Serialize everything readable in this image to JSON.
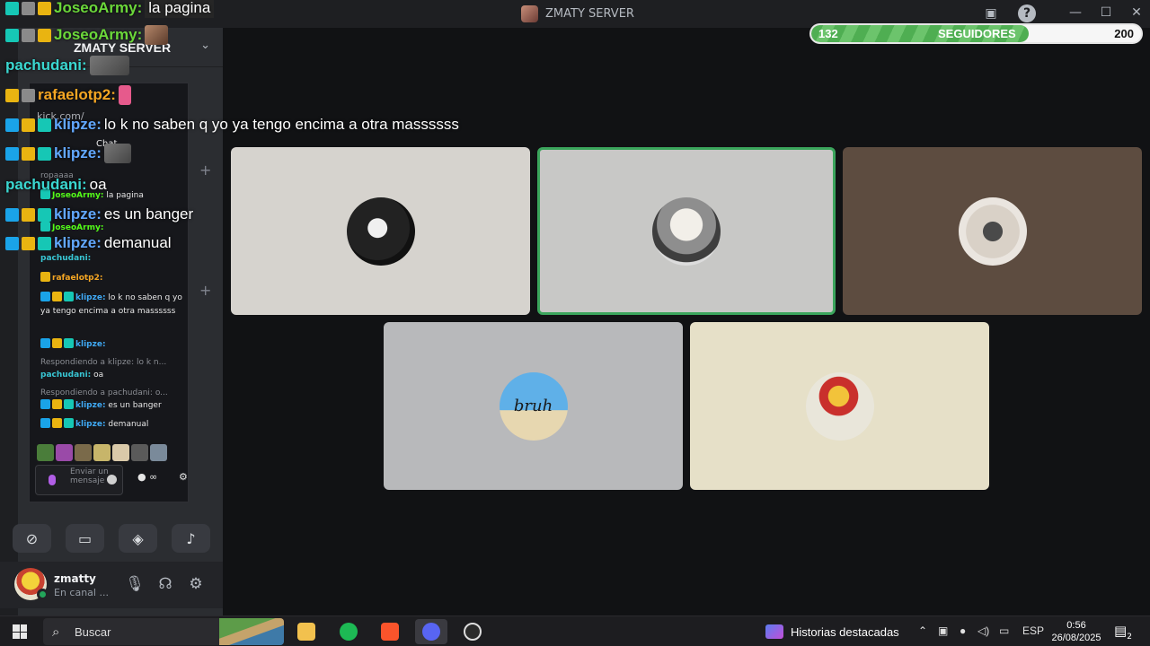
{
  "window": {
    "title": "ZMATY SERVER",
    "controls": {
      "minimize": "—",
      "maximize": "☐",
      "close": "✕"
    }
  },
  "followers_goal": {
    "current": "132",
    "label": "SEGUIDORES",
    "goal": "200",
    "progress": 0.66,
    "fill_color": "#4fae52"
  },
  "server": {
    "name": "ZMATY SERVER",
    "plus_a": "+",
    "plus_b": "+"
  },
  "kick_chat": {
    "url": "kick.com/",
    "tab": "Chat",
    "messages": [
      {
        "user": "",
        "text": "ropaaaa",
        "user_class": ""
      },
      {
        "user": "JoseoArmy:",
        "text": "la pagina",
        "user_class": "u-green"
      },
      {
        "user": "JoseoArmy:",
        "text": "",
        "user_class": "u-green"
      },
      {
        "user": "pachudani:",
        "text": "",
        "user_class": "u-teal"
      },
      {
        "user": "rafaelotp2:",
        "text": "",
        "user_class": "u-orange"
      },
      {
        "user": "klipze:",
        "text": "lo k no saben q yo ya tengo encima a otra massssss",
        "user_class": "u-blue"
      },
      {
        "user": "klipze:",
        "text": "",
        "user_class": "u-blue"
      },
      {
        "user": "",
        "text": "Respondiendo a klipze: lo k n...",
        "user_class": "reply"
      },
      {
        "user": "pachudani:",
        "text": "oa",
        "user_class": "u-teal"
      },
      {
        "user": "",
        "text": "Respondiendo a pachudani: o...",
        "user_class": "reply"
      },
      {
        "user": "klipze:",
        "text": "es un banger",
        "user_class": "u-blue"
      },
      {
        "user": "klipze:",
        "text": "demanual",
        "user_class": "u-blue"
      }
    ],
    "input_placeholder": "Enviar un mensaje",
    "infinity": "∞"
  },
  "overlay_chat": [
    {
      "user": "JoseoArmy:",
      "text": "la pagina",
      "color": "#53fc18"
    },
    {
      "user": "JoseoArmy:",
      "text": "",
      "color": "#53fc18"
    },
    {
      "user": "pachudani:",
      "text": "",
      "color": "#3ad7d0"
    },
    {
      "user": "rafaelotp2:",
      "text": "",
      "color": "#f5a623"
    },
    {
      "user": "klipze:",
      "text": "lo k no saben q yo ya tengo encima a otra massssss",
      "color": "#62a8ff"
    },
    {
      "user": "klipze:",
      "text": "",
      "color": "#62a8ff"
    },
    {
      "user": "pachudani:",
      "text": "oa",
      "color": "#3ad7d0"
    },
    {
      "user": "klipze:",
      "text": "es un banger",
      "color": "#62a8ff"
    },
    {
      "user": "klipze:",
      "text": "demanual",
      "color": "#62a8ff"
    }
  ],
  "tiles": [
    {
      "bg": "#d6d3ce",
      "avatar": "dark-skull",
      "speaking": false
    },
    {
      "bg": "#c8c8c6",
      "avatar": "tiger",
      "speaking": true
    },
    {
      "bg": "#5d4c40",
      "avatar": "cat-bows",
      "speaking": false
    },
    {
      "bg": "#b8b9bb",
      "avatar": "bruh-beach",
      "avatar_text": "bruh",
      "speaking": false
    },
    {
      "bg": "#e6e0c8",
      "avatar": "bart",
      "speaking": false
    }
  ],
  "user_panel": {
    "name": "zmatty",
    "status": "En canal ...",
    "icons": [
      "mic-icon",
      "headphones-icon",
      "settings-icon"
    ]
  },
  "media_buttons": [
    "camera-off-icon",
    "screen-share-icon",
    "activity-icon",
    "soundboard-icon"
  ],
  "taskbar": {
    "search_placeholder": "Buscar",
    "stories_label": "Historias destacadas",
    "language": "ESP",
    "time": "0:56",
    "date": "26/08/2025",
    "notifications": "2",
    "apps": [
      "file-explorer-icon",
      "spotify-icon",
      "brave-icon",
      "discord-icon",
      "obs-icon"
    ]
  }
}
